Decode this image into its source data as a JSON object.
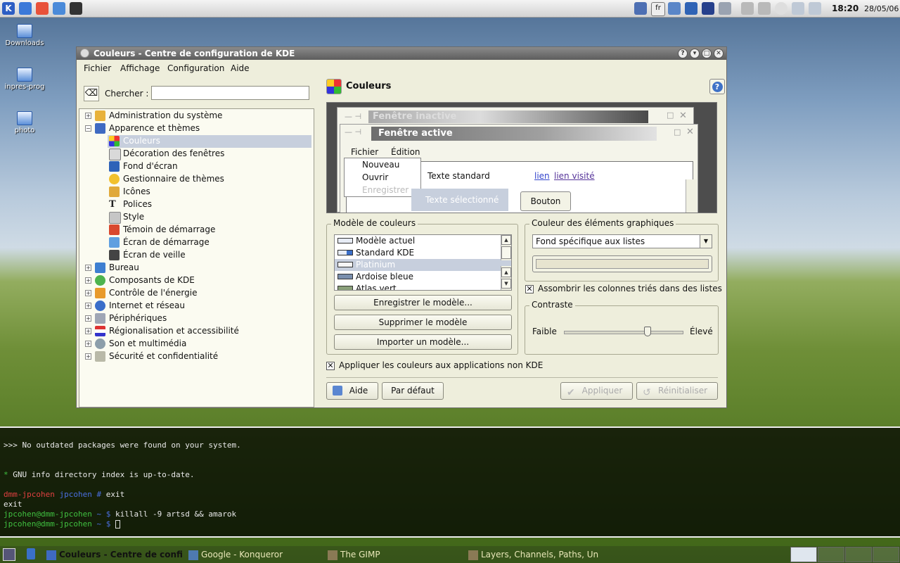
{
  "top_panel": {
    "clock": "18:20",
    "date": "28/05/06",
    "layout_indicator": "fr"
  },
  "desktop_icons": [
    {
      "label": "Downloads",
      "icon": "folder-icon"
    },
    {
      "label": "inpres-prog",
      "icon": "folder-icon"
    },
    {
      "label": "photo",
      "icon": "folder-icon"
    }
  ],
  "window": {
    "title": "Couleurs - Centre de configuration de KDE",
    "menu": [
      "Fichier",
      "Affichage",
      "Configuration",
      "Aide"
    ],
    "search_label": "Chercher :",
    "search_value": "",
    "tree": [
      {
        "label": "Administration du système",
        "level": 0,
        "toggle": "+"
      },
      {
        "label": "Apparence et thèmes",
        "level": 0,
        "toggle": "-"
      },
      {
        "label": "Couleurs",
        "level": 1,
        "selected": true
      },
      {
        "label": "Décoration des fenêtres",
        "level": 1
      },
      {
        "label": "Fond d'écran",
        "level": 1
      },
      {
        "label": "Gestionnaire de thèmes",
        "level": 1
      },
      {
        "label": "Icônes",
        "level": 1
      },
      {
        "label": "Polices",
        "level": 1
      },
      {
        "label": "Style",
        "level": 1
      },
      {
        "label": "Témoin de démarrage",
        "level": 1
      },
      {
        "label": "Écran de démarrage",
        "level": 1
      },
      {
        "label": "Écran de veille",
        "level": 1
      },
      {
        "label": "Bureau",
        "level": 0,
        "toggle": "+"
      },
      {
        "label": "Composants de KDE",
        "level": 0,
        "toggle": "+"
      },
      {
        "label": "Contrôle de l'énergie",
        "level": 0,
        "toggle": "+"
      },
      {
        "label": "Internet et réseau",
        "level": 0,
        "toggle": "+"
      },
      {
        "label": "Périphériques",
        "level": 0,
        "toggle": "+"
      },
      {
        "label": "Régionalisation et accessibilité",
        "level": 0,
        "toggle": "+"
      },
      {
        "label": "Son et multimédia",
        "level": 0,
        "toggle": "+"
      },
      {
        "label": "Sécurité et confidentialité",
        "level": 0,
        "toggle": "+"
      }
    ],
    "module_title": "Couleurs",
    "preview": {
      "inactive_title": "Fenêtre inactive",
      "active_title": "Fenêtre active",
      "menu": [
        "Fichier",
        "Édition"
      ],
      "dropdown": [
        "Nouveau",
        "Ouvrir",
        "Enregistrer"
      ],
      "standard_text": "Texte standard",
      "link": "lien",
      "visited_link": "lien visité",
      "selected_text": "Texte sélectionné",
      "button": "Bouton"
    },
    "scheme_group": {
      "title": "Modèle de couleurs",
      "items": [
        "Modèle actuel",
        "Standard KDE",
        "Platinium",
        "Ardoise bleue",
        "Atlas vert"
      ],
      "selected": "Platinium",
      "save": "Enregistrer le modèle...",
      "delete": "Supprimer le modèle",
      "import": "Importer un modèle..."
    },
    "widget_color_group": {
      "title": "Couleur des éléments graphiques",
      "combo_value": "Fond spécifique aux listes",
      "swatch_color": "#e7e4cf"
    },
    "darken_sorted": {
      "label": "Assombrir les colonnes triés dans des listes",
      "checked": true
    },
    "contrast": {
      "title": "Contraste",
      "low": "Faible",
      "high": "Élevé",
      "value_fraction": 0.7
    },
    "apply_non_kde": {
      "label": "Appliquer les couleurs aux applications non KDE",
      "checked": true
    },
    "buttons": {
      "help": "Aide",
      "defaults": "Par défaut",
      "apply": "Appliquer",
      "reset": "Réinitialiser"
    }
  },
  "terminal": {
    "lines": [
      ">>> No outdated packages were found on your system.",
      "",
      "",
      " * GNU info directory index is up-to-date.",
      "",
      "dmm-jpcohen jpcohen # exit",
      "exit",
      "jpcohen@dmm-jpcohen ~ $ killall -9 artsd && amarok",
      "jpcohen@dmm-jpcohen ~ $ "
    ]
  },
  "taskbar": {
    "tasks": [
      {
        "label": "Couleurs - Centre de confi",
        "active": true
      },
      {
        "label": "Google - Konqueror",
        "active": false
      },
      {
        "label": "The GIMP",
        "active": false
      },
      {
        "label": "Layers, Channels, Paths, Un",
        "active": false
      }
    ]
  },
  "colors": {
    "window_bg": "#eeeedc",
    "selection": "#c7cfdd",
    "link": "#3344cc",
    "visited_link": "#553399"
  }
}
